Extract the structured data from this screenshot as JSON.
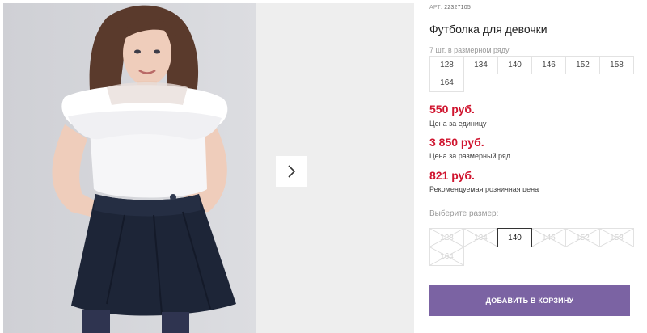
{
  "product": {
    "sku_label": "АРТ:",
    "sku": "22327105",
    "title": "Футболка для девочки"
  },
  "gallery": {
    "image": "girl-in-white-ruffled-blouse-and-navy-skirt",
    "next_icon": "chevron-right-icon"
  },
  "size_row": {
    "count_text": "7 шт. в размерном ряду",
    "sizes": [
      "128",
      "134",
      "140",
      "146",
      "152",
      "158",
      "164"
    ]
  },
  "prices": {
    "unit_price": "550 руб.",
    "unit_label": "Цена за единицу",
    "row_price": "3 850 руб.",
    "row_label": "Цена за размерный ряд",
    "retail_price": "821 руб.",
    "retail_label": "Рекомендуемая розничная цена"
  },
  "size_picker": {
    "label": "Выберите размер:",
    "options": [
      "128",
      "134",
      "140",
      "146",
      "152",
      "158",
      "164"
    ],
    "available": [
      "140"
    ],
    "selected": "140"
  },
  "cart": {
    "button_label": "ДОБАВИТЬ В КОРЗИНУ"
  },
  "colors": {
    "price": "#d0152f",
    "button": "#7b63a3"
  }
}
